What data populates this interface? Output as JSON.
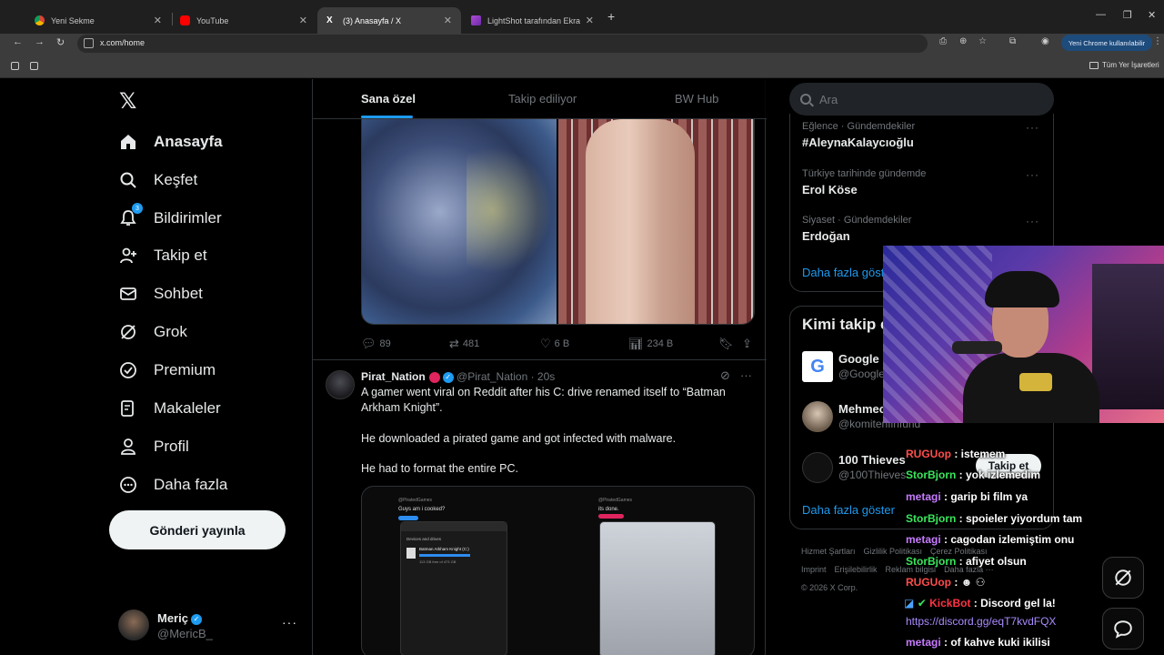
{
  "browser": {
    "tabs": [
      {
        "title": "Yeni Sekme",
        "icon": "chrome-icon"
      },
      {
        "title": "YouTube",
        "icon": "youtube-icon"
      },
      {
        "title": "(3) Anasayfa / X",
        "icon": "x-icon"
      },
      {
        "title": "LightShot tarafından Ekran Gör",
        "icon": "lightshot-icon"
      }
    ],
    "url": "x.com/home",
    "chrome_pill": "Yeni Chrome kullanılabilir",
    "bookmarks_all": "Tüm Yer İşaretleri"
  },
  "nav": {
    "items": [
      {
        "label": "Anasayfa",
        "icon": "home-icon"
      },
      {
        "label": "Keşfet",
        "icon": "search-icon"
      },
      {
        "label": "Bildirimler",
        "icon": "bell-icon",
        "badge": "3"
      },
      {
        "label": "Takip et",
        "icon": "follow-icon"
      },
      {
        "label": "Sohbet",
        "icon": "mail-icon"
      },
      {
        "label": "Grok",
        "icon": "grok-icon"
      },
      {
        "label": "Premium",
        "icon": "premium-icon"
      },
      {
        "label": "Makaleler",
        "icon": "articles-icon"
      },
      {
        "label": "Profil",
        "icon": "profile-icon"
      },
      {
        "label": "Daha fazla",
        "icon": "more-icon"
      }
    ],
    "post_button": "Gönderi yayınla",
    "profile": {
      "name": "Meriç",
      "handle": "@MericB_"
    }
  },
  "feed": {
    "tabs": [
      "Sana özel",
      "Takip ediliyor",
      "BW Hub"
    ],
    "tweet1_actions": {
      "replies": "89",
      "retweets": "481",
      "likes": "6 B",
      "views": "234 B"
    },
    "tweet2": {
      "name": "Pirat_Nation",
      "handle": "@Pirat_Nation",
      "time": "20s",
      "lines": [
        "A gamer went viral on Reddit after his C: drive renamed itself to “Batman Arkham Knight”.",
        "He downloaded a pirated game and got infected with malware.",
        "He had to format the entire PC."
      ],
      "shot_left": {
        "caption": "Guys am i cooked?",
        "drive_label": "Batman Arkham Knight (C:)",
        "drive_free": "113 GB free of 473 GB",
        "section": "Devices and drives"
      },
      "shot_right": {
        "caption": "its done."
      }
    }
  },
  "right": {
    "search_placeholder": "Ara",
    "trends": [
      {
        "category": "Eğlence · Gündemdekiler",
        "title": "#AleynaKalaycıoğlu"
      },
      {
        "category": "Türkiye tarihinde gündemde",
        "title": "Erol Köse"
      },
      {
        "category": "Siyaset · Gündemdekiler",
        "title": "Erdoğan"
      }
    ],
    "trends_more": "Daha fazla göster",
    "who_title": "Kimi takip e",
    "who": [
      {
        "name": "Google",
        "handle": "@Google",
        "icon": "google-icon"
      },
      {
        "name": "Mehmec",
        "handle": "@komitenfinfund",
        "icon": "avatar"
      },
      {
        "name": "100 Thieves",
        "handle": "@100Thieves",
        "icon": "100thieves-icon"
      }
    ],
    "follow_label": "Takip et",
    "who_more": "Daha fazla göster",
    "footer": [
      "Hizmet Şartları",
      "Gizlilik Politikası",
      "Çerez Politikası",
      "Imprint",
      "Erişilebilirlik",
      "Reklam bilgisi",
      "Daha fazla ···",
      "© 2026 X Corp."
    ]
  },
  "chat": [
    {
      "user": "RUGUop",
      "msg": " : istemem",
      "cls": "u-rug"
    },
    {
      "user": "StorBjorn",
      "msg": " : yok izlemedim",
      "cls": "u-storb"
    },
    {
      "user": "metagi",
      "msg": " : garip bi film ya",
      "cls": "u-metagi"
    },
    {
      "user": "StorBjorn",
      "msg": " : spoieler yiyordum tam",
      "cls": "u-storb"
    },
    {
      "user": "metagi",
      "msg": " : cagodan izlemiştim onu",
      "cls": "u-metagi"
    },
    {
      "user": "StorBjorn",
      "msg": " : afiyet olsun",
      "cls": "u-storb"
    },
    {
      "user": "RUGUop",
      "msg": " : ",
      "cls": "u-rug"
    },
    {
      "user": "KickBot",
      "msg": " : Discord gel la!",
      "cls": "u-kick"
    },
    {
      "user": "",
      "msg": "https://discord.gg/eqT7kvdFQX",
      "cls": "link"
    },
    {
      "user": "metagi",
      "msg": " : of kahve kuki ikilisi",
      "cls": "u-metagi"
    }
  ]
}
